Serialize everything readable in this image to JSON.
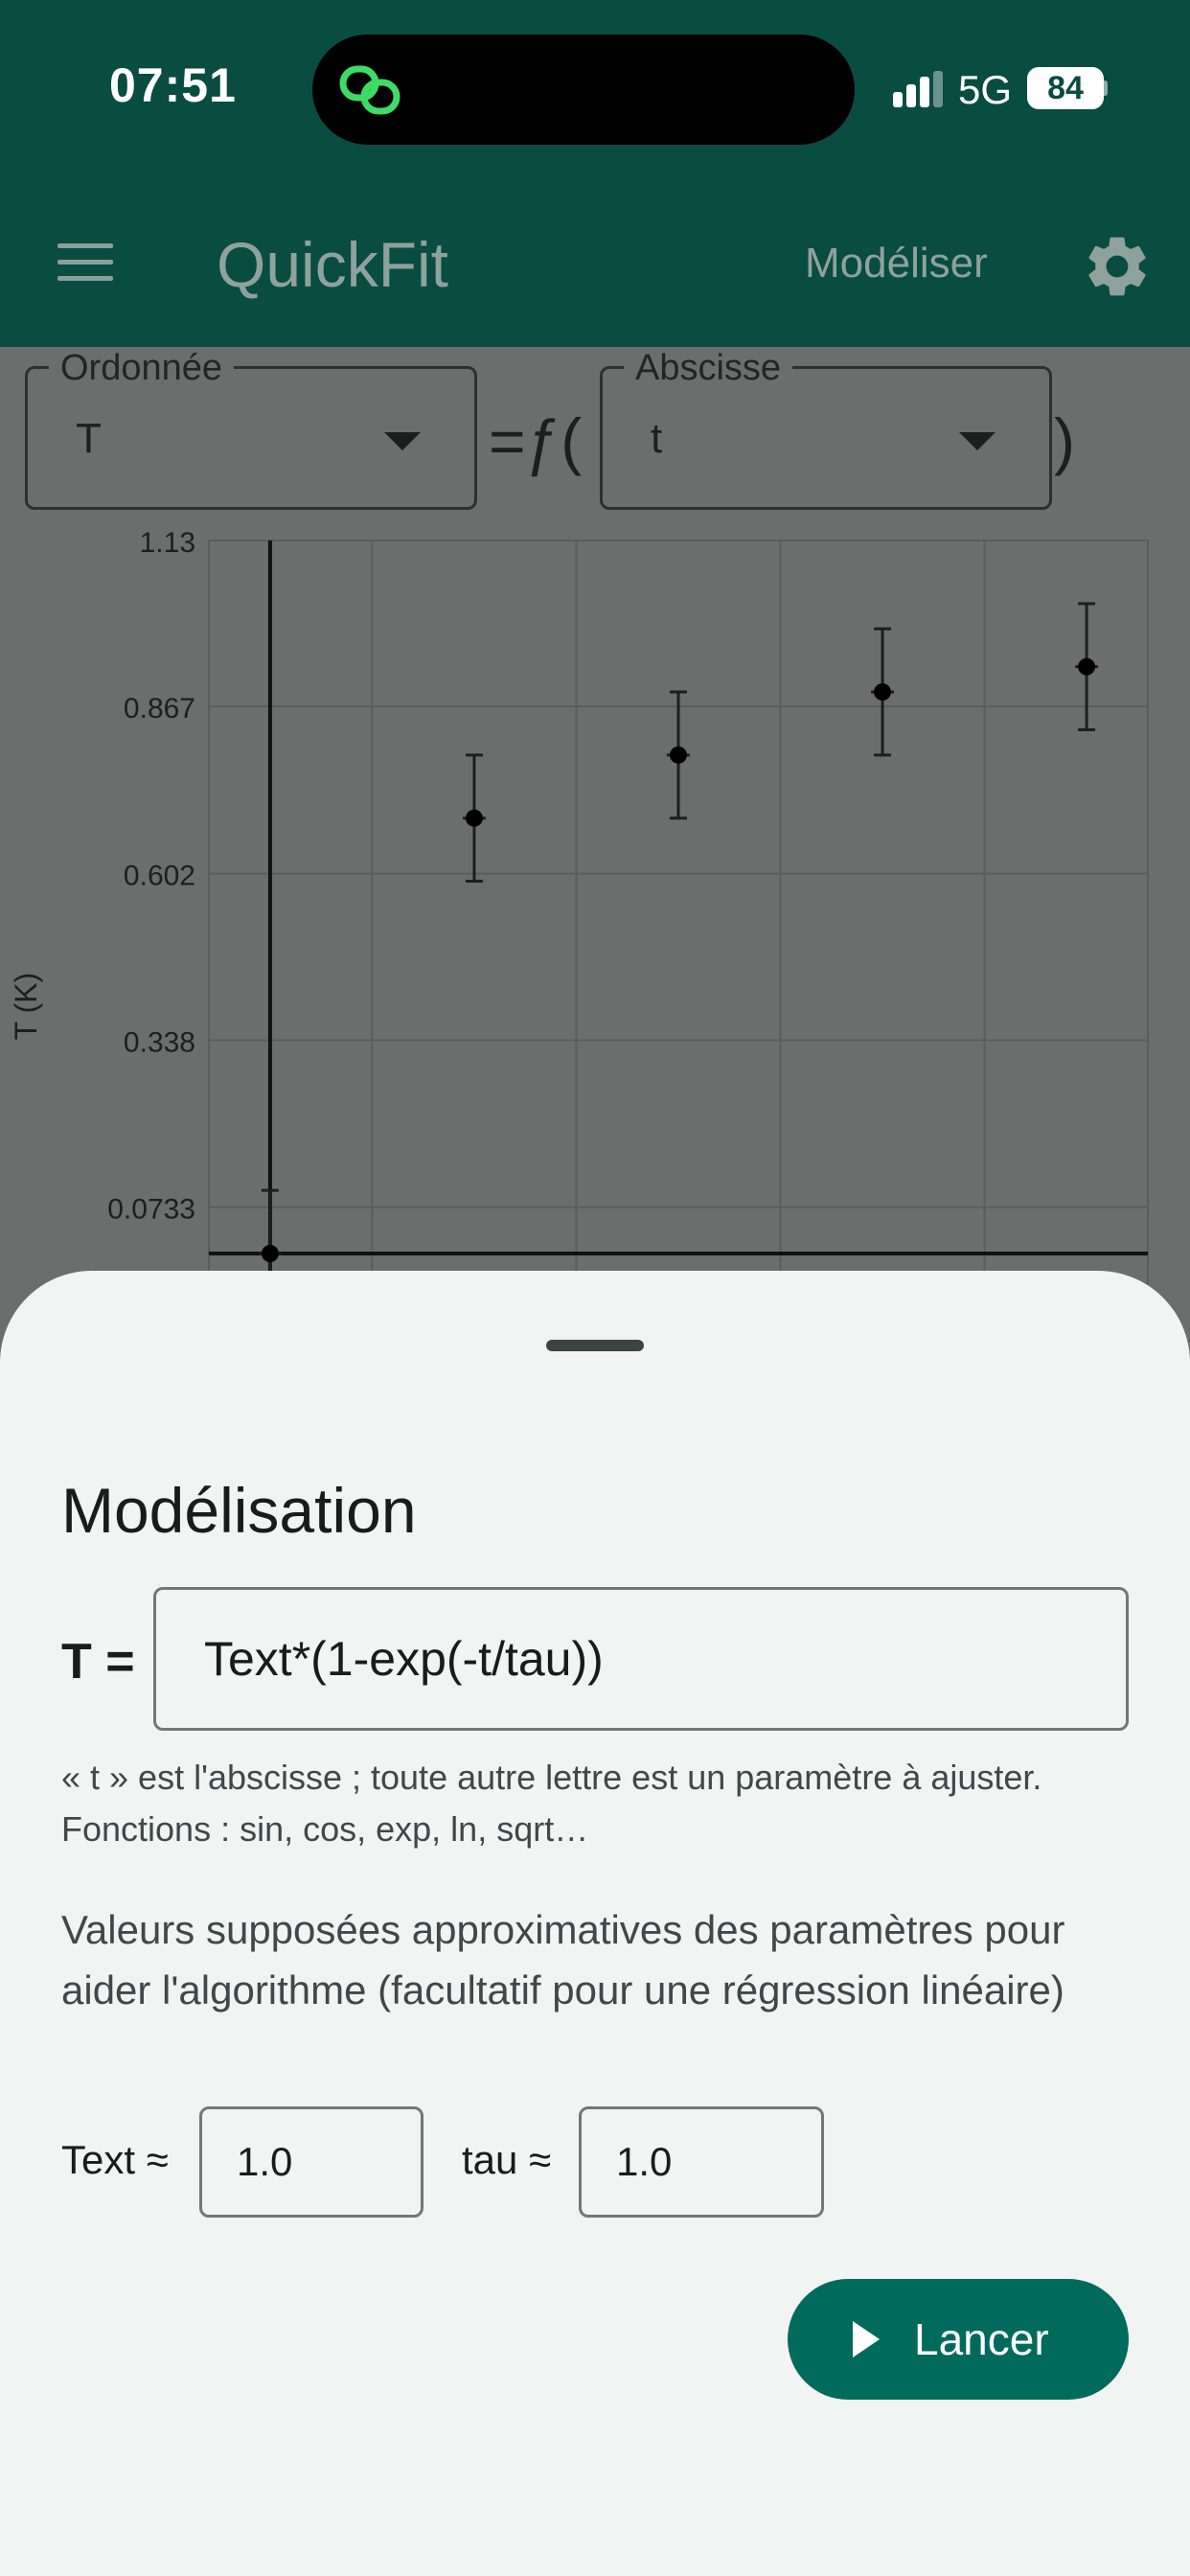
{
  "status_bar": {
    "time": "07:51",
    "network": "5G",
    "battery": "84",
    "signal_bars": 3
  },
  "app_bar": {
    "title": "QuickFit",
    "action": "Modéliser",
    "menu_icon": "hamburger-menu-icon",
    "settings_icon": "gear-icon"
  },
  "selectors": {
    "ordinate_label": "Ordonnée",
    "ordinate_value": "T",
    "equals_f": "=ƒ(",
    "abscissa_label": "Abscisse",
    "abscissa_value": "t",
    "close_paren": ")"
  },
  "chart_data": {
    "type": "scatter",
    "ylabel": "T (K)",
    "ytick_labels": [
      "1.13",
      "0.867",
      "0.602",
      "0.338",
      "0.0733"
    ],
    "ylim": [
      0.0,
      1.13
    ],
    "grid": true,
    "series": [
      {
        "points": [
          {
            "x": 0,
            "y": 0.0,
            "yerr": 0.1
          },
          {
            "x": 1,
            "y": 0.69,
            "yerr": 0.1
          },
          {
            "x": 2,
            "y": 0.79,
            "yerr": 0.1
          },
          {
            "x": 3,
            "y": 0.89,
            "yerr": 0.1
          },
          {
            "x": 4,
            "y": 0.93,
            "yerr": 0.1
          }
        ]
      }
    ],
    "xlim": [
      -0.3,
      4.3
    ]
  },
  "sheet": {
    "title": "Modélisation",
    "lhs": "T =",
    "formula": "Text*(1-exp(-t/tau))",
    "hint": "« t » est l'abscisse ; toute autre lettre est un paramètre à ajuster. Fonctions : sin, cos, exp, ln, sqrt…",
    "description": "Valeurs supposées approximatives des paramètres pour aider l'algorithme (facultatif pour une régression linéaire)",
    "params": [
      {
        "label": "Text ≈",
        "value": "1.0"
      },
      {
        "label": "tau ≈",
        "value": "1.0"
      }
    ],
    "run_label": "Lancer",
    "run_icon": "play-icon"
  },
  "colors": {
    "primary": "#094c41",
    "accent": "#006b5c",
    "scrim": "#6b6e6d",
    "surface": "#f1f4f3",
    "island_icon": "#3ddc64"
  }
}
